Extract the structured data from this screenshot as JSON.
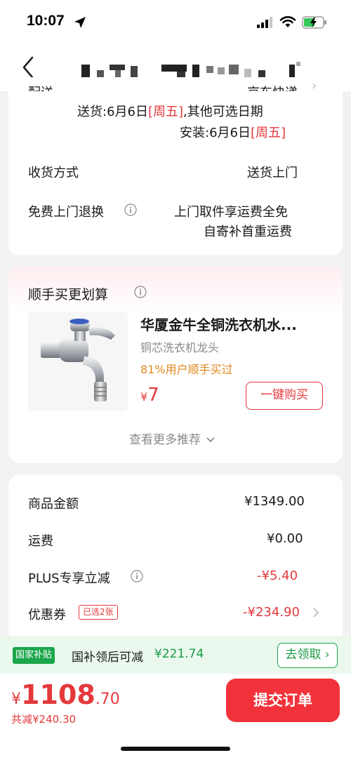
{
  "status_bar": {
    "time": "10:07"
  },
  "delivery": {
    "clipped_left": "配送",
    "clipped_right": "京东快递",
    "ship_line": "送货:6月6日",
    "ship_day": "[周五]",
    "ship_tail": ",其他可选日期",
    "install_line": "安装:6月6日",
    "install_day": "[周五]",
    "receive_label": "收货方式",
    "receive_value": "送货上门",
    "return_label": "免费上门退换",
    "return_value_1": "上门取件享运费全免",
    "return_value_2": "自寄补首重运费"
  },
  "recommend": {
    "title": "顺手买更划算",
    "product_name": "华厦金牛全铜洗衣机水...",
    "product_subtitle": "铜芯洗衣机龙头",
    "product_stat": "81%用户顺手买过",
    "price_symbol": "¥",
    "price_value": "7",
    "buy_button": "一键购买",
    "more_link": "查看更多推荐"
  },
  "summary": {
    "rows": [
      {
        "label": "商品金额",
        "value": "¥1349.00"
      },
      {
        "label": "运费",
        "value": "¥0.00"
      },
      {
        "label": "PLUS专享立减",
        "value": "-¥5.40"
      },
      {
        "label": "优惠券",
        "value": "-¥234.90"
      }
    ],
    "coupon_tag": "已选2张"
  },
  "subsidy": {
    "badge": "国家补贴",
    "text": "国补领后可减",
    "amount": "¥221.74",
    "claim_button": "去领取"
  },
  "bottom": {
    "currency": "¥",
    "total_int": "1108",
    "total_dec": ".70",
    "saved": "共减¥240.30",
    "submit_button": "提交订单"
  },
  "colors": {
    "accent_red": "#e4393c",
    "subsidy_green": "#1aa64a",
    "submit_red": "#f2323a"
  }
}
